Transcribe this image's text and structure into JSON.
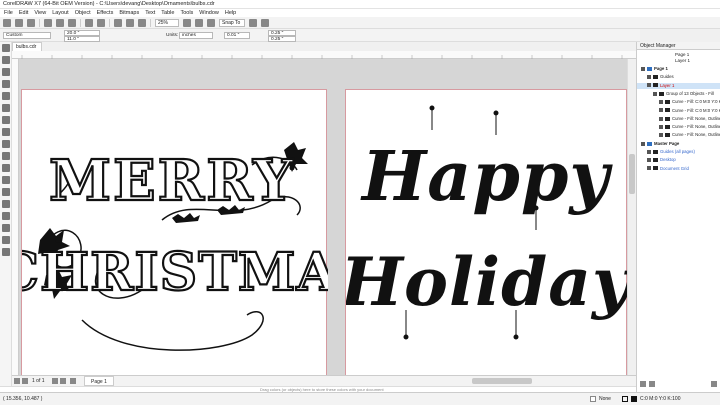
{
  "window": {
    "title": "CorelDRAW X7 (64-Bit OEM Version) - C:\\Users\\devang\\Desktop\\Ornaments\\bulbs.cdr"
  },
  "menu": [
    "File",
    "Edit",
    "View",
    "Layout",
    "Object",
    "Effects",
    "Bitmaps",
    "Text",
    "Table",
    "Tools",
    "Window",
    "Help"
  ],
  "toolbar": {
    "zoom": "25%",
    "snap_to": "Snap To"
  },
  "property_bar": {
    "preset": "Custom",
    "width": "20.0 \"",
    "height": "11.0 \"",
    "units_label": "Units:",
    "units": "inches",
    "nudge": "0.01 \"",
    "dup_x": "0.25 \"",
    "dup_y": "0.25 \""
  },
  "document_tab": "bulbs.cdr",
  "artwork": {
    "left": {
      "line1": "MERRY",
      "line2": "CHRISTMAS"
    },
    "right": {
      "line1": "Happy",
      "line2": "Holiday"
    }
  },
  "page_nav": {
    "counter": "1 of 1",
    "page_tab": "Page 1"
  },
  "drag_hint": "Drag colors (or objects) here to store these colors with your document",
  "status": {
    "coords": "( 15.356, 10.487 )",
    "fill": "None",
    "outline": "C:0 M:0 Y:0 K:100"
  },
  "object_manager": {
    "title": "Object Manager",
    "page": "Page 1",
    "layer": "Layer 1",
    "rows": [
      {
        "label": "Page 1",
        "indent": 0,
        "bold": true
      },
      {
        "label": "Guides",
        "indent": 1
      },
      {
        "label": "Layer 1",
        "indent": 1,
        "color": "#cc0000"
      },
      {
        "label": "Group of 13 Objects - Fill",
        "indent": 2
      },
      {
        "label": "Curve - Fill: C:0 M:0 Y:0 K:100",
        "indent": 3
      },
      {
        "label": "Curve - Fill: C:0 M:0 Y:0 K:100",
        "indent": 3
      },
      {
        "label": "Curve - Fill: None, Outline",
        "indent": 3
      },
      {
        "label": "Curve - Fill: None, Outline",
        "indent": 3
      },
      {
        "label": "Curve - Fill: None, Outline",
        "indent": 3
      },
      {
        "label": "Master Page",
        "indent": 0,
        "bold": true
      },
      {
        "label": "Guides (all pages)",
        "indent": 1,
        "color": "#3366cc"
      },
      {
        "label": "Desktop",
        "indent": 1,
        "color": "#3366cc"
      },
      {
        "label": "Document Grid",
        "indent": 1,
        "color": "#3366cc"
      }
    ]
  },
  "colors": {
    "accent": "#2f6fbf",
    "page_border": "#d79aa0",
    "selection": "#cfe3f7"
  }
}
